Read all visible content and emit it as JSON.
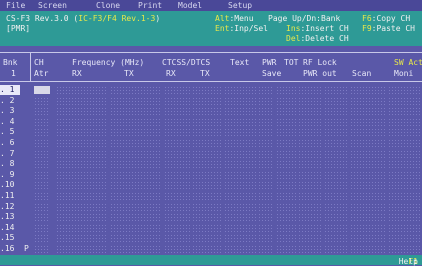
{
  "menu": [
    "File",
    "Screen",
    "Clone",
    "Print",
    "Model",
    "Setup"
  ],
  "info": {
    "left": {
      "line1_prefix": "CS-F3 Rev.3.0 (",
      "line1_model": "IC-F3/F4 Rev.1-3",
      "line1_suffix": ")",
      "line2": "[PMR]"
    },
    "keys": [
      {
        "key": "Alt",
        "sep": ":",
        "label": "Menu"
      },
      {
        "key": "Page Up/Dn",
        "sep": ":",
        "label": "Bank"
      },
      {
        "key": "F6",
        "sep": ":",
        "label": "Copy CH"
      },
      {
        "key": "Ent",
        "sep": ":",
        "label": "Inp/Sel"
      },
      {
        "key": "Ins",
        "sep": ":",
        "label": "Insert CH"
      },
      {
        "key": "F9",
        "sep": ":",
        "label": "Paste CH"
      },
      {
        "key": "Del",
        "sep": ":",
        "label": "Delete CH"
      }
    ]
  },
  "header": {
    "row1": [
      "Bnk",
      "CH",
      "Frequency (MHz)",
      "CTCSS/DTCS",
      "Text",
      "PWR",
      "TOT",
      "RF Lock",
      "SW Act"
    ],
    "row2": [
      "1",
      "Atr",
      "RX",
      "TX",
      "RX",
      "TX",
      "Save",
      "PWR out",
      "Scan",
      "Moni"
    ]
  },
  "rows": [
    {
      "num": ". 1",
      "mark": ""
    },
    {
      "num": ". 2",
      "mark": ""
    },
    {
      "num": ". 3",
      "mark": ""
    },
    {
      "num": ". 4",
      "mark": ""
    },
    {
      "num": ". 5",
      "mark": ""
    },
    {
      "num": ". 6",
      "mark": ""
    },
    {
      "num": ". 7",
      "mark": ""
    },
    {
      "num": ". 8",
      "mark": ""
    },
    {
      "num": ". 9",
      "mark": ""
    },
    {
      "num": ".10",
      "mark": ""
    },
    {
      "num": ".11",
      "mark": ""
    },
    {
      "num": ".12",
      "mark": ""
    },
    {
      "num": ".13",
      "mark": ""
    },
    {
      "num": ".14",
      "mark": ""
    },
    {
      "num": ".15",
      "mark": ""
    },
    {
      "num": ".16",
      "mark": "P"
    }
  ],
  "selected_row": 0,
  "status": {
    "key": "F1",
    "sep": ":",
    "label": "Help"
  }
}
